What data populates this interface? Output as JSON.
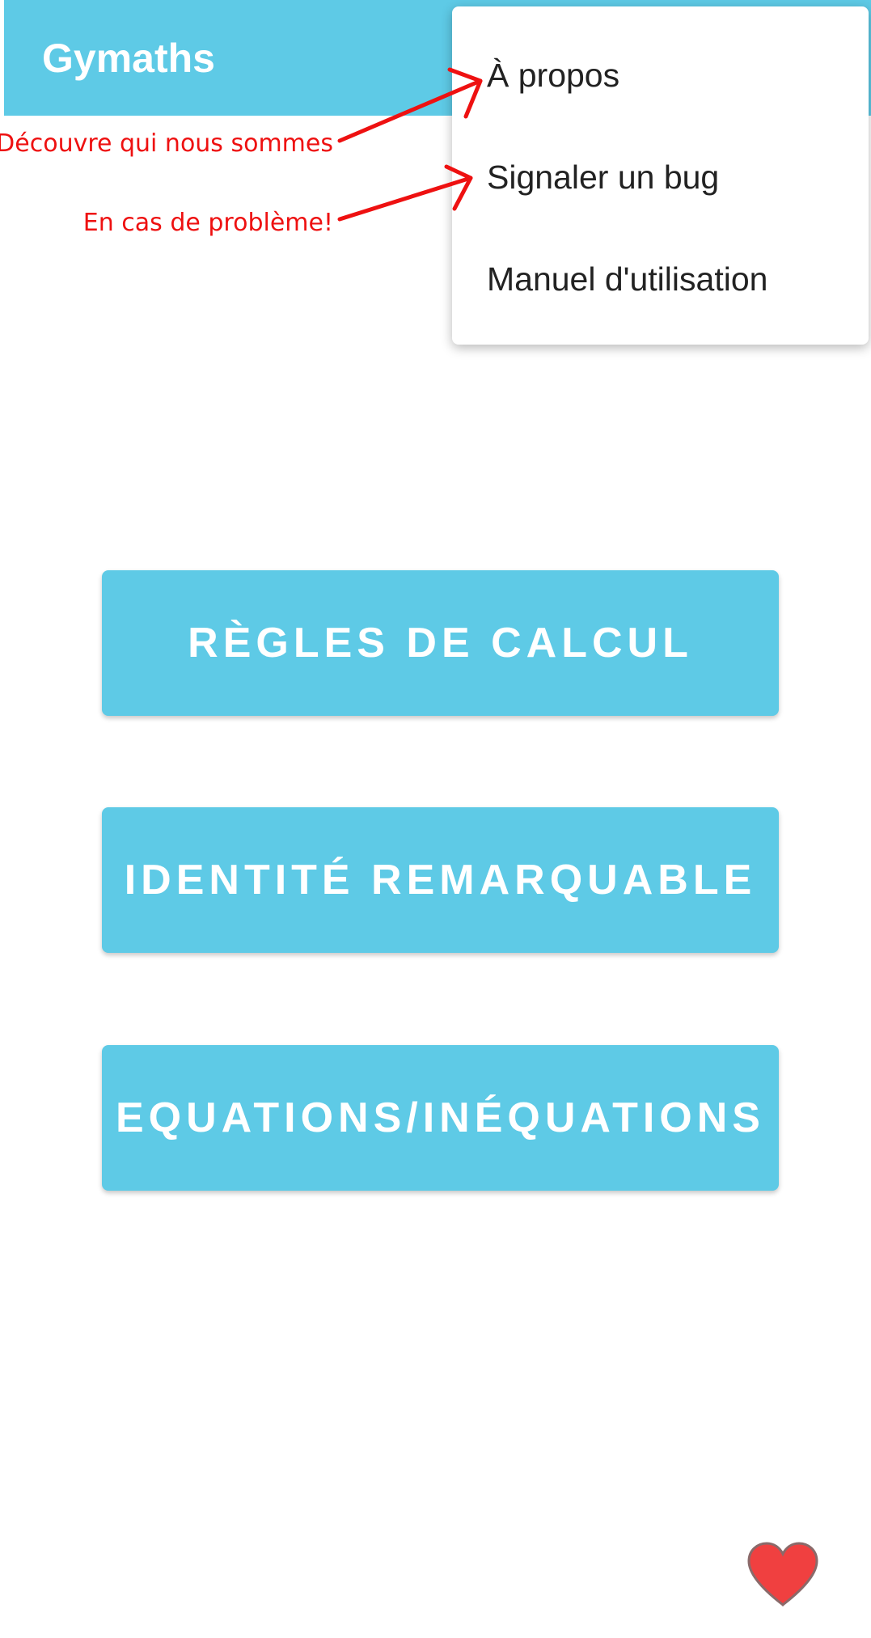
{
  "app_bar": {
    "title": "Gymaths"
  },
  "overflow_menu": {
    "items": [
      {
        "label": "À propos"
      },
      {
        "label": "Signaler un bug"
      },
      {
        "label": "Manuel d'utilisation"
      }
    ]
  },
  "annotations": [
    {
      "text": "Découvre qui nous sommes",
      "points_to": "À propos"
    },
    {
      "text": "En cas de problème!",
      "points_to": "Signaler un bug"
    }
  ],
  "main": {
    "buttons": [
      {
        "label": "RÈGLES DE CALCUL"
      },
      {
        "label": "IDENTITÉ REMARQUABLE"
      },
      {
        "label": "EQUATIONS/INÉQUATIONS"
      }
    ]
  },
  "favorite": {
    "icon": "heart-icon"
  },
  "colors": {
    "accent": "#5ecae6",
    "annotation": "#ee1111",
    "heart": "#f04040"
  }
}
